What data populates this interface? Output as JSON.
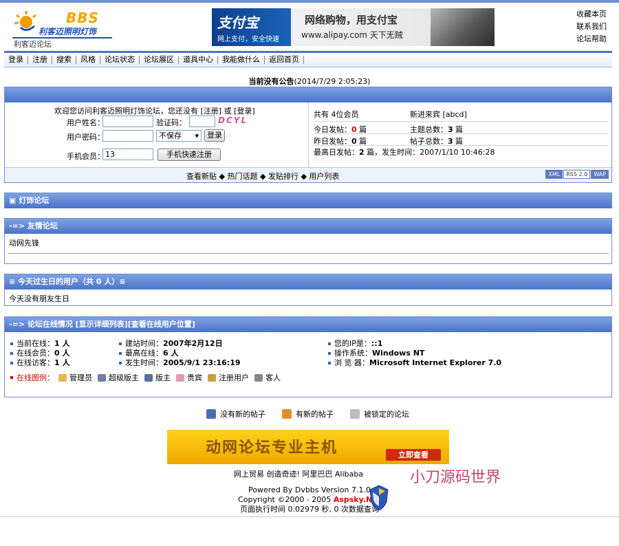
{
  "header": {
    "logo_bbs": "BBS",
    "logo_name": "利客迈照明灯饰",
    "logo_sub": "利客迈论坛",
    "banner": {
      "brand": "支付宝",
      "tagline": "网上支付，安全快速",
      "slogan": "网络购物，用支付宝",
      "url": "www.alipay.com 天下无贼"
    },
    "top_links": [
      "收藏本页",
      "联系我们",
      "论坛帮助"
    ]
  },
  "nav": {
    "items": [
      "登录",
      "注册",
      "搜索",
      "风格",
      "论坛状态",
      "论坛展区",
      "道具中心",
      "我能做什么",
      "返回首页"
    ]
  },
  "announcement": {
    "text": "当前没有公告",
    "time": "(2014/7/29 2:05:23)"
  },
  "login": {
    "welcome": "欢迎您访问利客迈照明灯饰论坛，您还没有 [注册] 或 [登录]",
    "username_label": "用户姓名：",
    "captcha_label": "验证码：",
    "captcha_text": "DCYL",
    "password_label": "用户密码：",
    "save_option": "不保存",
    "login_button": "登录",
    "mobile_label": "手机会员：",
    "mobile_value": "13",
    "mobile_register_button": "手机快速注册"
  },
  "stats": {
    "members": "共有 4位会员",
    "newest": "新进来宾 [abcd]",
    "today_posts_label": "今日发帖：",
    "today_posts": "0",
    "topics_label": "主题总数：",
    "topics": "3",
    "yesterday_label": "昨日发帖：",
    "yesterday": "0",
    "posts_label": "帖子总数：",
    "posts": "3",
    "unit": "篇",
    "max_day": "最高日发帖：",
    "max_value": "2",
    "max_tail": "篇，发生时间：2007/1/10 10:46:28"
  },
  "login_footer": {
    "links": [
      "查看新贴",
      "热门话题",
      "发贴排行",
      "用户列表"
    ],
    "badges": [
      "XML",
      "RSS 2.0",
      "WAP"
    ]
  },
  "sections": {
    "light_forum": "灯饰论坛",
    "friend_links_title": "-=> 友情论坛",
    "friend_link": "动网先锋",
    "birthday_title": "≡ 今天过生日的用户（共 0 人）≡",
    "birthday_text": "今天没有朋友生日",
    "online_title": "-=> 论坛在线情况 [显示详细列表][查看在线用户位置]"
  },
  "online": {
    "current_label": "当前在线：",
    "current": "1 人",
    "members_label": "在线会员：",
    "members": "0 人",
    "guests_label": "在线访客：",
    "guests": "1 人",
    "founded_label": "建站时间：",
    "founded": "2007年2月12日",
    "peak_label": "最高在线：",
    "peak": "6 人",
    "peak_time_label": "发生时间：",
    "peak_time": "2005/9/1 23:16:19",
    "ip_label": "您的IP是：",
    "ip": "::1",
    "os_label": "操作系统：",
    "os": "Windows NT",
    "browser_label": "浏 览 器：",
    "browser": "Microsoft Internet Explorer 7.0",
    "legend_label": "在线图例：",
    "legend": [
      "管理员",
      "超级版主",
      "版主",
      "贵宾",
      "注册用户",
      "客人"
    ]
  },
  "status_legend": [
    "没有新的帖子",
    "有新的帖子",
    "被锁定的论坛"
  ],
  "ad": {
    "title": "动网论坛专业主机",
    "button": "立即查看",
    "links": "网上贸易 创造奇迹! 阿里巴巴 Alibaba"
  },
  "watermark": "小刀源码世界",
  "footer": {
    "powered": "Powered By Dvbbs Version 7.1.0",
    "copyright": "Copyright ©2000 - 2005",
    "brand": "Aspsky.Net",
    "exec": "页面执行时间 0.02979 秒, 0 次数据查询"
  },
  "colors": {
    "accent": "#4a73c9",
    "title_bar": "#7da2e3",
    "highlight_red": "#dd0000"
  }
}
